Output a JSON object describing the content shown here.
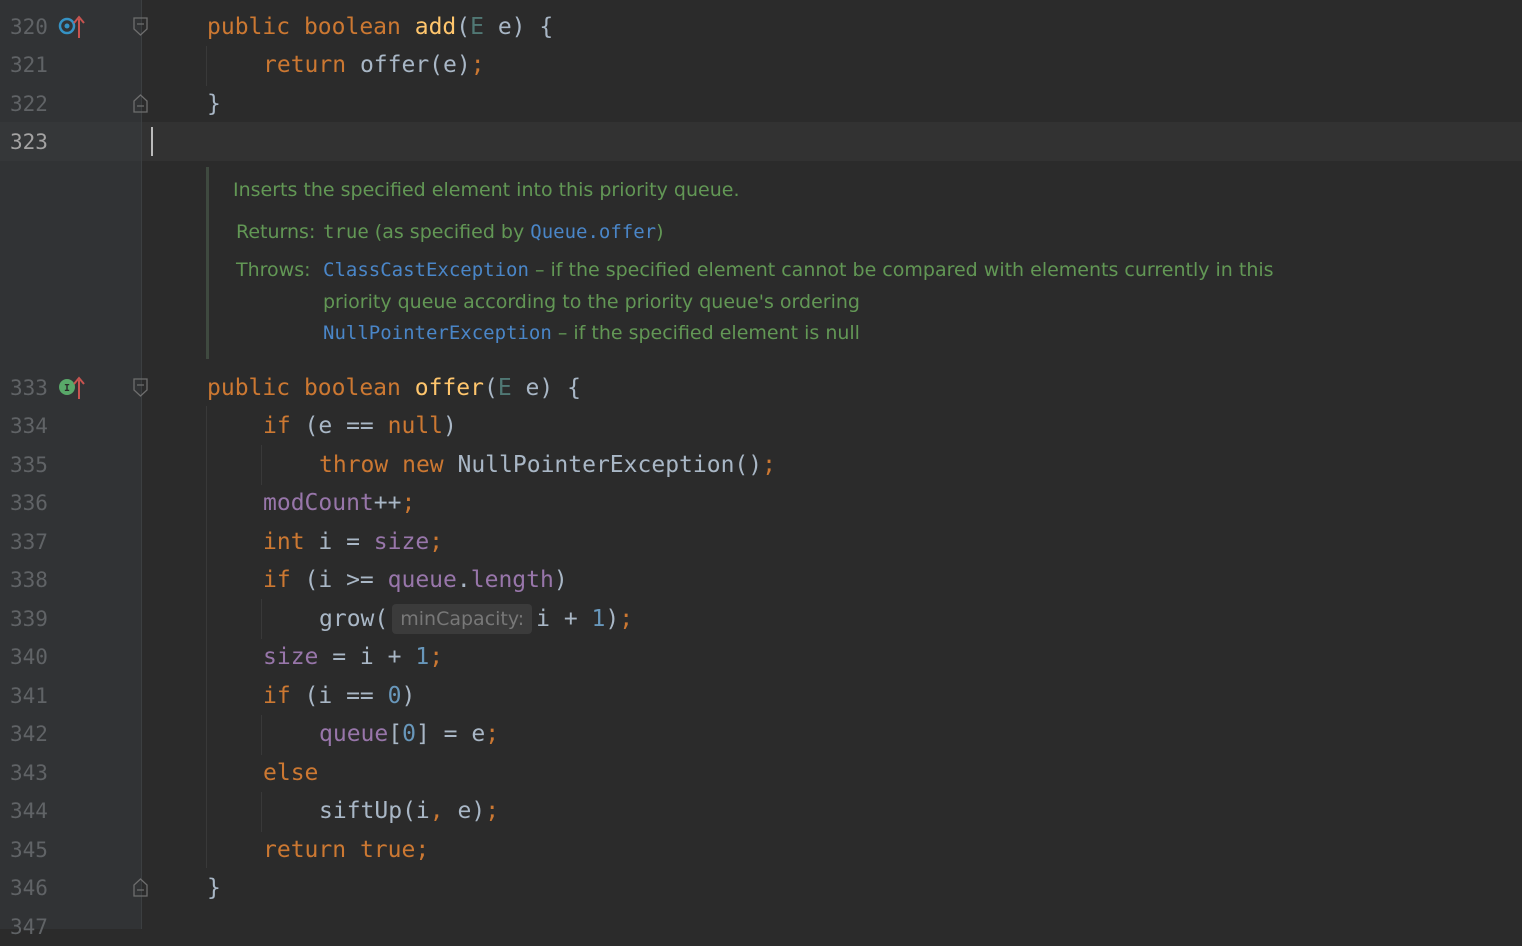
{
  "editor": {
    "lines": [
      {
        "no": "320",
        "tokens": [
          [
            "kw",
            "public "
          ],
          [
            "kw",
            "boolean "
          ],
          [
            "fn",
            "add"
          ],
          [
            "pl",
            "("
          ],
          [
            "tp",
            "E"
          ],
          [
            "pl",
            " e) {"
          ]
        ]
      },
      {
        "no": "321",
        "tokens": [
          [
            "kw",
            "return "
          ],
          [
            "pl",
            "offer(e)"
          ],
          [
            "kw",
            ";"
          ]
        ]
      },
      {
        "no": "322",
        "tokens": [
          [
            "pl",
            "}"
          ]
        ]
      },
      {
        "no": "323",
        "tokens": []
      },
      {
        "no": "333",
        "tokens": [
          [
            "kw",
            "public "
          ],
          [
            "kw",
            "boolean "
          ],
          [
            "fn",
            "offer"
          ],
          [
            "pl",
            "("
          ],
          [
            "tp",
            "E"
          ],
          [
            "pl",
            " e) {"
          ]
        ]
      },
      {
        "no": "334",
        "tokens": [
          [
            "kw",
            "if "
          ],
          [
            "pl",
            "(e == "
          ],
          [
            "kw",
            "null"
          ],
          [
            "pl",
            ")"
          ]
        ]
      },
      {
        "no": "335",
        "tokens": [
          [
            "kw",
            "throw "
          ],
          [
            "kw",
            "new "
          ],
          [
            "pl",
            "NullPointerException()"
          ],
          [
            "kw",
            ";"
          ]
        ]
      },
      {
        "no": "336",
        "tokens": [
          [
            "fld",
            "modCount"
          ],
          [
            "pl",
            "++"
          ],
          [
            "kw",
            ";"
          ]
        ]
      },
      {
        "no": "337",
        "tokens": [
          [
            "kw",
            "int "
          ],
          [
            "pl",
            "i = "
          ],
          [
            "fld",
            "size"
          ],
          [
            "kw",
            ";"
          ]
        ]
      },
      {
        "no": "338",
        "tokens": [
          [
            "kw",
            "if "
          ],
          [
            "pl",
            "(i >= "
          ],
          [
            "fld",
            "queue"
          ],
          [
            "pl",
            "."
          ],
          [
            "fld",
            "length"
          ],
          [
            "pl",
            ")"
          ]
        ]
      },
      {
        "no": "339",
        "tokens": [
          [
            "pl",
            "grow("
          ],
          [
            "hint",
            "minCapacity:"
          ],
          [
            "pl",
            "i + "
          ],
          [
            "num",
            "1"
          ],
          [
            "pl",
            ")"
          ],
          [
            "kw",
            ";"
          ]
        ]
      },
      {
        "no": "340",
        "tokens": [
          [
            "fld",
            "size"
          ],
          [
            "pl",
            " = i + "
          ],
          [
            "num",
            "1"
          ],
          [
            "kw",
            ";"
          ]
        ]
      },
      {
        "no": "341",
        "tokens": [
          [
            "kw",
            "if "
          ],
          [
            "pl",
            "(i == "
          ],
          [
            "num",
            "0"
          ],
          [
            "pl",
            ")"
          ]
        ]
      },
      {
        "no": "342",
        "tokens": [
          [
            "fld",
            "queue"
          ],
          [
            "pl",
            "["
          ],
          [
            "num",
            "0"
          ],
          [
            "pl",
            "] = e"
          ],
          [
            "kw",
            ";"
          ]
        ]
      },
      {
        "no": "343",
        "tokens": [
          [
            "kw",
            "else"
          ]
        ]
      },
      {
        "no": "344",
        "tokens": [
          [
            "pl",
            "siftUp(i"
          ],
          [
            "kw",
            ", "
          ],
          [
            "pl",
            "e)"
          ],
          [
            "kw",
            ";"
          ]
        ]
      },
      {
        "no": "345",
        "tokens": [
          [
            "kw",
            "return "
          ],
          [
            "kw",
            "true"
          ],
          [
            "kw",
            ";"
          ]
        ]
      },
      {
        "no": "346",
        "tokens": [
          [
            "pl",
            "}"
          ]
        ]
      },
      {
        "no": "347",
        "tokens": []
      }
    ]
  },
  "javadoc": {
    "summary": "Inserts the specified element into this priority queue.",
    "returns_label": "Returns:",
    "returns_value": "true",
    "returns_text_pre": " (as specified by ",
    "returns_ref": "Queue.offer",
    "returns_text_post": ")",
    "throws_label": "Throws:",
    "throws_1_ref": "ClassCastException",
    "throws_1_text": " – if the specified element cannot be compared with elements currently in this",
    "throws_1_text_cont": "priority queue according to the priority queue's ordering",
    "throws_2_ref": "NullPointerException",
    "throws_2_text": " – if the specified element is null"
  },
  "icons": {
    "line_320": "overrides-method-icon",
    "line_333": "implements-method-icon"
  }
}
